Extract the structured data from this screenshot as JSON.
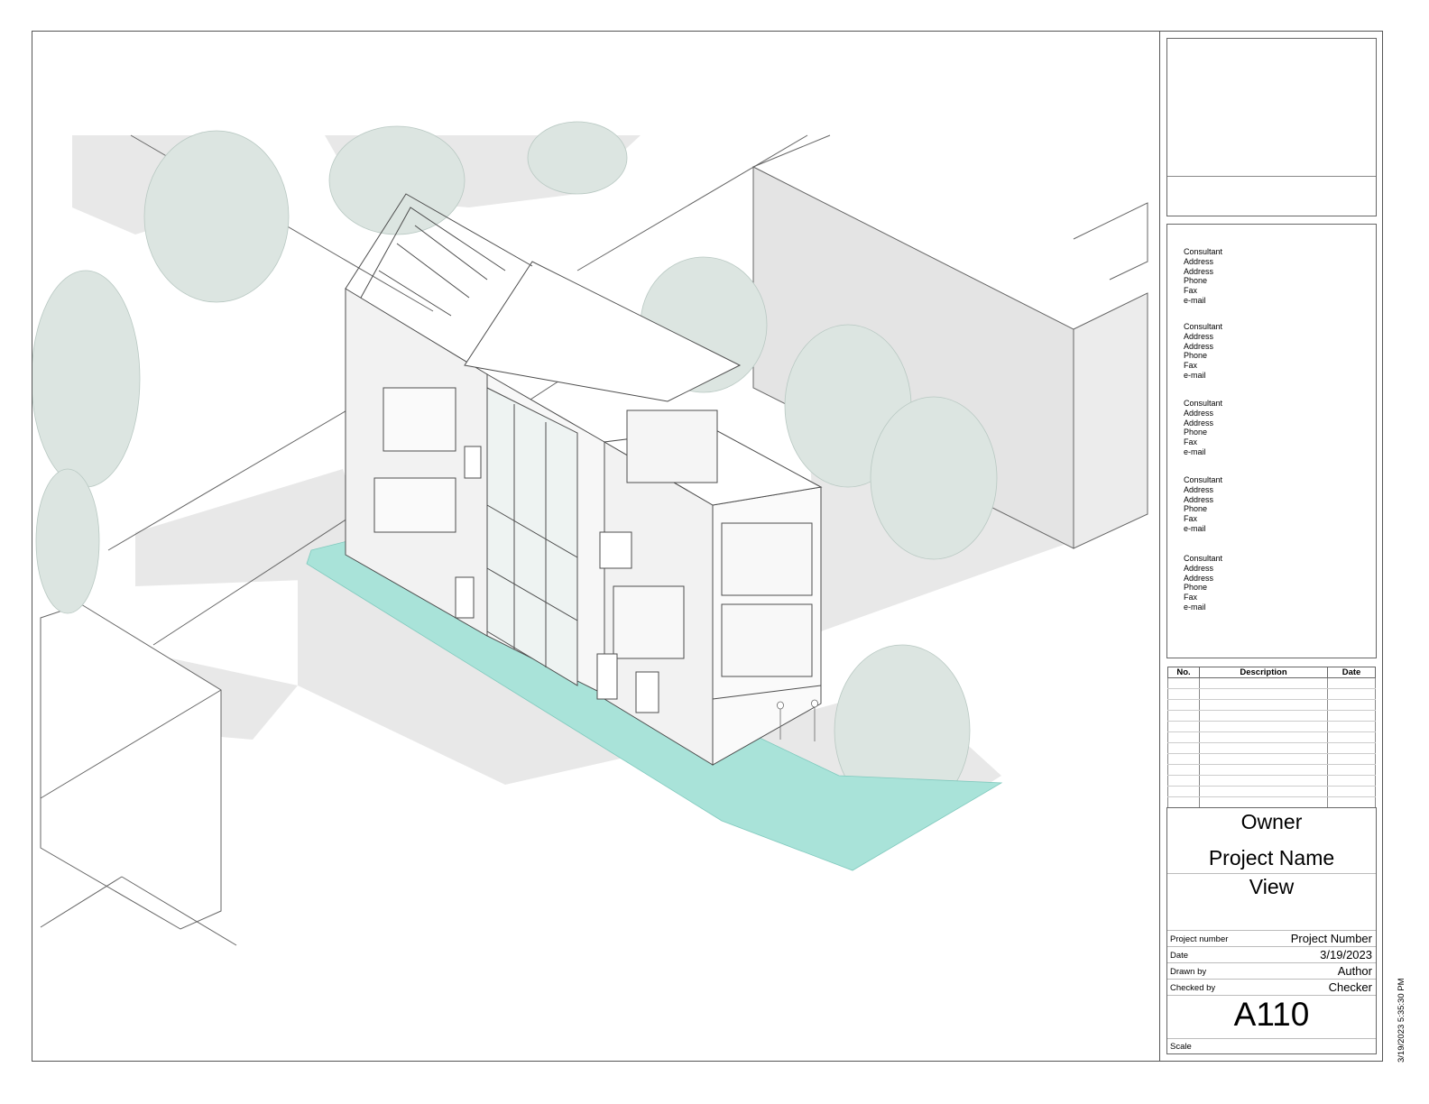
{
  "colors": {
    "line": "#4d4d4d",
    "shadow": "#e6e6e6",
    "tree": "#d8e2de",
    "accent_path": "#a9e3d9",
    "border": "#555555"
  },
  "consultants": [
    {
      "name": "Consultant",
      "address1": "Address",
      "address2": "Address",
      "phone": "Phone",
      "fax": "Fax",
      "email": "e-mail"
    },
    {
      "name": "Consultant",
      "address1": "Address",
      "address2": "Address",
      "phone": "Phone",
      "fax": "Fax",
      "email": "e-mail"
    },
    {
      "name": "Consultant",
      "address1": "Address",
      "address2": "Address",
      "phone": "Phone",
      "fax": "Fax",
      "email": "e-mail"
    },
    {
      "name": "Consultant",
      "address1": "Address",
      "address2": "Address",
      "phone": "Phone",
      "fax": "Fax",
      "email": "e-mail"
    },
    {
      "name": "Consultant",
      "address1": "Address",
      "address2": "Address",
      "phone": "Phone",
      "fax": "Fax",
      "email": "e-mail"
    }
  ],
  "revisions": {
    "headers": {
      "no": "No.",
      "description": "Description",
      "date": "Date"
    },
    "rows": []
  },
  "title_block": {
    "owner": "Owner",
    "project_name": "Project Name",
    "view": "View",
    "fields": [
      {
        "label": "Project number",
        "value": "Project Number"
      },
      {
        "label": "Date",
        "value": "3/19/2023"
      },
      {
        "label": "Drawn by",
        "value": "Author"
      },
      {
        "label": "Checked by",
        "value": "Checker"
      }
    ],
    "sheet_number": "A110",
    "scale_label": "Scale"
  },
  "timestamp": "3/19/2023 5:35:30 PM"
}
